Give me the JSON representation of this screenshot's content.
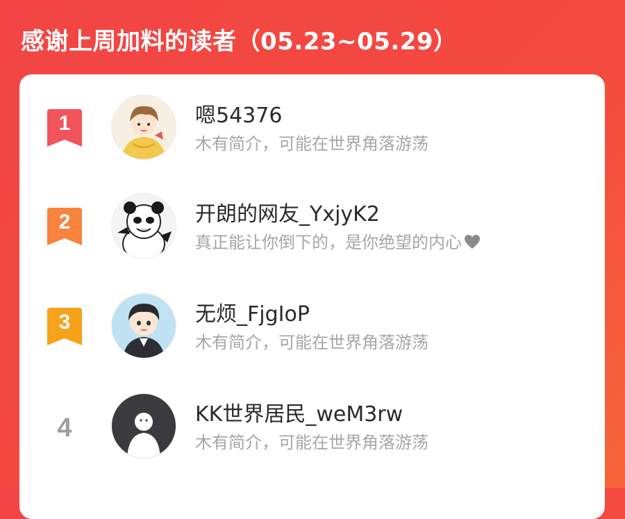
{
  "header": {
    "title": "感谢上周加料的读者（05.23~05.29）"
  },
  "colors": {
    "background": "#f24545",
    "rank_1": "#f2545b",
    "rank_2": "#f7833f",
    "rank_3": "#f7a21b",
    "rank_plain": "#9e9e9e"
  },
  "readers": [
    {
      "rank": "1",
      "name": "嗯54376",
      "bio": "木有简介，可能在世界角落游荡",
      "avatar": "cartoon-boy-yellow-hoodie-avatar"
    },
    {
      "rank": "2",
      "name": "开朗的网友_YxjyK2",
      "bio": "真正能让你倒下的，是你绝望的内心",
      "bio_icon": "heart-icon",
      "avatar": "panda-meme-avatar"
    },
    {
      "rank": "3",
      "name": "无烦_FjgIoP",
      "bio": "木有简介，可能在世界角落游荡",
      "avatar": "cartoon-boy-suit-avatar"
    },
    {
      "rank": "4",
      "name": "KK世界居民_weM3rw",
      "bio": "木有简介，可能在世界角落游荡",
      "avatar": "default-user-avatar"
    }
  ]
}
